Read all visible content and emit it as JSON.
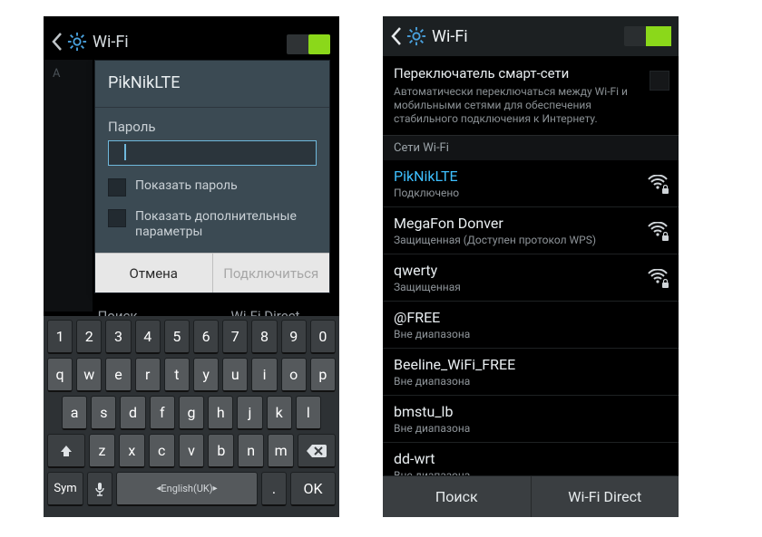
{
  "left": {
    "header_title": "Wi-Fi",
    "dialog": {
      "title": "PikNikLTE",
      "password_label": "Пароль",
      "show_password": "Показать пароль",
      "show_advanced": "Показать дополнительные параметры",
      "cancel": "Отмена",
      "connect": "Подключиться"
    },
    "bottom_tabs": {
      "search": "Поиск",
      "wifidirect": "Wi-Fi Direct"
    },
    "dim_label": "A",
    "keyboard": {
      "row1": [
        "1",
        "2",
        "3",
        "4",
        "5",
        "6",
        "7",
        "8",
        "9",
        "0"
      ],
      "row2": [
        "q",
        "w",
        "e",
        "r",
        "t",
        "y",
        "u",
        "i",
        "o",
        "p"
      ],
      "row3": [
        "a",
        "s",
        "d",
        "f",
        "g",
        "h",
        "j",
        "k",
        "l"
      ],
      "row4_letters": [
        "z",
        "x",
        "c",
        "v",
        "b",
        "n",
        "m"
      ],
      "sym": "Sym",
      "lang": "English(UK)",
      "dot": ".",
      "ok": "OK"
    }
  },
  "right": {
    "header_title": "Wi-Fi",
    "smart": {
      "title": "Переключатель смарт-сети",
      "desc": "Автоматически переключаться между Wi-Fi и мобильными сетями для обеспечения стабильного подключения к Интернету."
    },
    "section_label": "Сети Wi-Fi",
    "networks": [
      {
        "name": "PikNikLTE",
        "status": "Подключено",
        "connected": true,
        "locked": true,
        "signal": true
      },
      {
        "name": "MegaFon Donver",
        "status": "Защищенная (Доступен протокол WPS)",
        "connected": false,
        "locked": true,
        "signal": true
      },
      {
        "name": "qwerty",
        "status": "Защищенная",
        "connected": false,
        "locked": true,
        "signal": true
      },
      {
        "name": "@FREE",
        "status": "Вне диапазона",
        "connected": false,
        "locked": false,
        "signal": false
      },
      {
        "name": "Beeline_WiFi_FREE",
        "status": "Вне диапазона",
        "connected": false,
        "locked": false,
        "signal": false
      },
      {
        "name": "bmstu_lb",
        "status": "Вне диапазона",
        "connected": false,
        "locked": false,
        "signal": false
      },
      {
        "name": "dd-wrt",
        "status": "Вне диапазона",
        "connected": false,
        "locked": false,
        "signal": false
      }
    ],
    "bottom": {
      "search": "Поиск",
      "wifidirect": "Wi-Fi Direct"
    }
  }
}
